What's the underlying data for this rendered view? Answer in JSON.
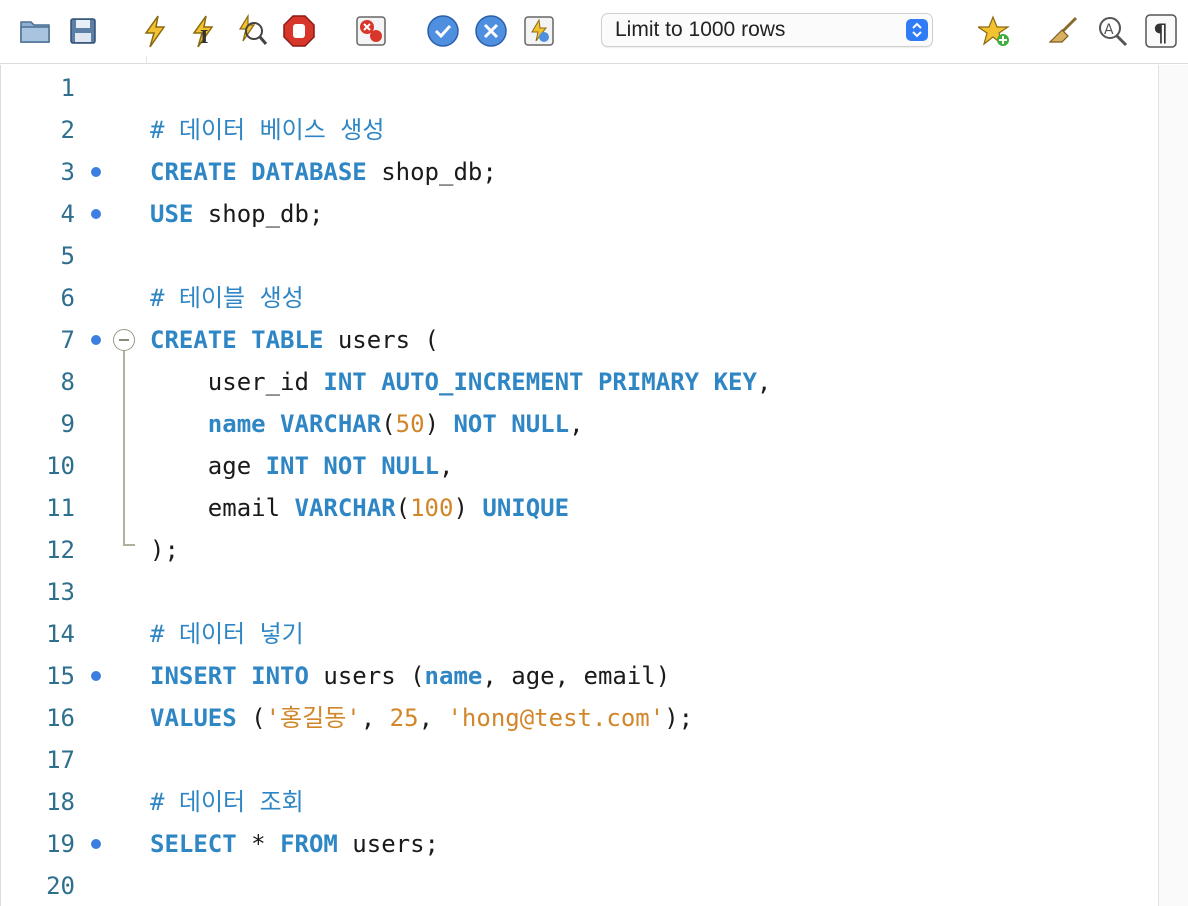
{
  "toolbar": {
    "buttons": [
      {
        "name": "open-folder-icon"
      },
      {
        "name": "save-icon"
      },
      {
        "name": "execute-all-icon"
      },
      {
        "name": "execute-current-icon"
      },
      {
        "name": "explain-icon"
      },
      {
        "name": "stop-icon"
      },
      {
        "name": "toggle-error-stop-icon"
      },
      {
        "name": "commit-icon"
      },
      {
        "name": "rollback-icon"
      },
      {
        "name": "autocommit-icon"
      },
      {
        "name": "add-snippet-icon"
      },
      {
        "name": "beautify-icon"
      },
      {
        "name": "find-icon"
      },
      {
        "name": "invisible-chars-icon"
      }
    ],
    "limit_select": {
      "value": "Limit to 1000 rows"
    }
  },
  "editor": {
    "lines": [
      {
        "n": "1",
        "marker": false,
        "tokens": []
      },
      {
        "n": "2",
        "marker": false,
        "tokens": [
          {
            "t": "# 데이터 베이스 생성",
            "c": "cm"
          }
        ]
      },
      {
        "n": "3",
        "marker": true,
        "tokens": [
          {
            "t": "CREATE",
            "c": "kw"
          },
          {
            "t": " "
          },
          {
            "t": "DATABASE",
            "c": "kw"
          },
          {
            "t": " shop_db;"
          }
        ]
      },
      {
        "n": "4",
        "marker": true,
        "tokens": [
          {
            "t": "USE",
            "c": "kw"
          },
          {
            "t": " shop_db;"
          }
        ]
      },
      {
        "n": "5",
        "marker": false,
        "tokens": []
      },
      {
        "n": "6",
        "marker": false,
        "tokens": [
          {
            "t": "# 테이블 생성",
            "c": "cm"
          }
        ]
      },
      {
        "n": "7",
        "marker": true,
        "tokens": [
          {
            "t": "CREATE",
            "c": "kw"
          },
          {
            "t": " "
          },
          {
            "t": "TABLE",
            "c": "kw"
          },
          {
            "t": " users ("
          }
        ]
      },
      {
        "n": "8",
        "marker": false,
        "tokens": [
          {
            "t": "    user_id "
          },
          {
            "t": "INT",
            "c": "kw"
          },
          {
            "t": " "
          },
          {
            "t": "AUTO_INCREMENT",
            "c": "kw"
          },
          {
            "t": " "
          },
          {
            "t": "PRIMARY",
            "c": "kw"
          },
          {
            "t": " "
          },
          {
            "t": "KEY",
            "c": "kw"
          },
          {
            "t": ","
          }
        ]
      },
      {
        "n": "9",
        "marker": false,
        "tokens": [
          {
            "t": "    "
          },
          {
            "t": "name",
            "c": "kw"
          },
          {
            "t": " "
          },
          {
            "t": "VARCHAR",
            "c": "kw"
          },
          {
            "t": "("
          },
          {
            "t": "50",
            "c": "num"
          },
          {
            "t": ") "
          },
          {
            "t": "NOT",
            "c": "kw"
          },
          {
            "t": " "
          },
          {
            "t": "NULL",
            "c": "kw"
          },
          {
            "t": ","
          }
        ]
      },
      {
        "n": "10",
        "marker": false,
        "tokens": [
          {
            "t": "    age "
          },
          {
            "t": "INT",
            "c": "kw"
          },
          {
            "t": " "
          },
          {
            "t": "NOT",
            "c": "kw"
          },
          {
            "t": " "
          },
          {
            "t": "NULL",
            "c": "kw"
          },
          {
            "t": ","
          }
        ]
      },
      {
        "n": "11",
        "marker": false,
        "tokens": [
          {
            "t": "    email "
          },
          {
            "t": "VARCHAR",
            "c": "kw"
          },
          {
            "t": "("
          },
          {
            "t": "100",
            "c": "num"
          },
          {
            "t": ") "
          },
          {
            "t": "UNIQUE",
            "c": "kw"
          }
        ]
      },
      {
        "n": "12",
        "marker": false,
        "tokens": [
          {
            "t": ");"
          }
        ]
      },
      {
        "n": "13",
        "marker": false,
        "tokens": []
      },
      {
        "n": "14",
        "marker": false,
        "tokens": [
          {
            "t": "# 데이터 넣기",
            "c": "cm"
          }
        ]
      },
      {
        "n": "15",
        "marker": true,
        "tokens": [
          {
            "t": "INSERT",
            "c": "kw"
          },
          {
            "t": " "
          },
          {
            "t": "INTO",
            "c": "kw"
          },
          {
            "t": " users ("
          },
          {
            "t": "name",
            "c": "kw"
          },
          {
            "t": ", age, email)"
          }
        ]
      },
      {
        "n": "16",
        "marker": false,
        "tokens": [
          {
            "t": "VALUES",
            "c": "kw"
          },
          {
            "t": " ("
          },
          {
            "t": "'홍길동'",
            "c": "str"
          },
          {
            "t": ", "
          },
          {
            "t": "25",
            "c": "num"
          },
          {
            "t": ", "
          },
          {
            "t": "'hong@test.com'",
            "c": "str"
          },
          {
            "t": ");"
          }
        ]
      },
      {
        "n": "17",
        "marker": false,
        "tokens": []
      },
      {
        "n": "18",
        "marker": false,
        "tokens": [
          {
            "t": "# 데이터 조회",
            "c": "cm"
          }
        ]
      },
      {
        "n": "19",
        "marker": true,
        "tokens": [
          {
            "t": "SELECT",
            "c": "kw"
          },
          {
            "t": " * "
          },
          {
            "t": "FROM",
            "c": "kw"
          },
          {
            "t": " users;"
          }
        ]
      },
      {
        "n": "20",
        "marker": false,
        "tokens": []
      }
    ]
  }
}
